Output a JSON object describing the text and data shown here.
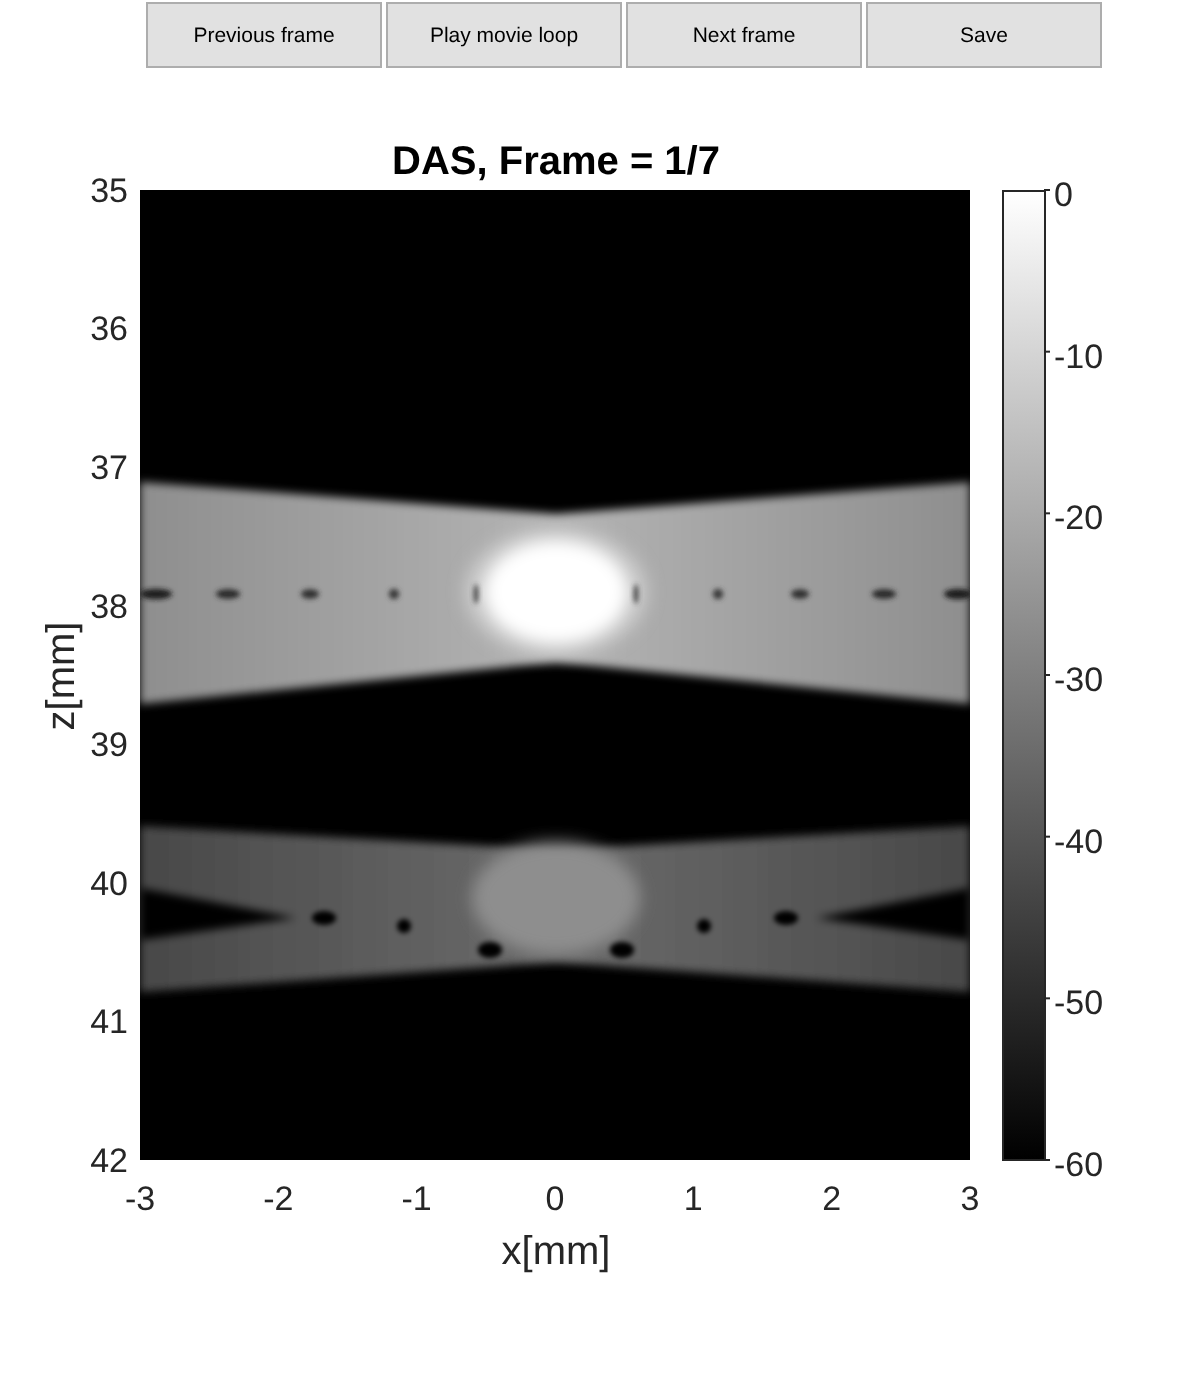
{
  "toolbar": {
    "buttons": [
      "Previous frame",
      "Play movie loop",
      "Next frame",
      "Save"
    ]
  },
  "plot": {
    "title": "DAS, Frame = 1/7",
    "xlabel": "x[mm]",
    "ylabel": "z[mm]",
    "xticks": [
      "-3",
      "-2",
      "-1",
      "0",
      "1",
      "2",
      "3"
    ],
    "yticks": [
      "35",
      "36",
      "37",
      "38",
      "39",
      "40",
      "41",
      "42"
    ]
  },
  "colorbar": {
    "ticks": [
      "0",
      "-10",
      "-20",
      "-30",
      "-40",
      "-50",
      "-60"
    ]
  }
}
